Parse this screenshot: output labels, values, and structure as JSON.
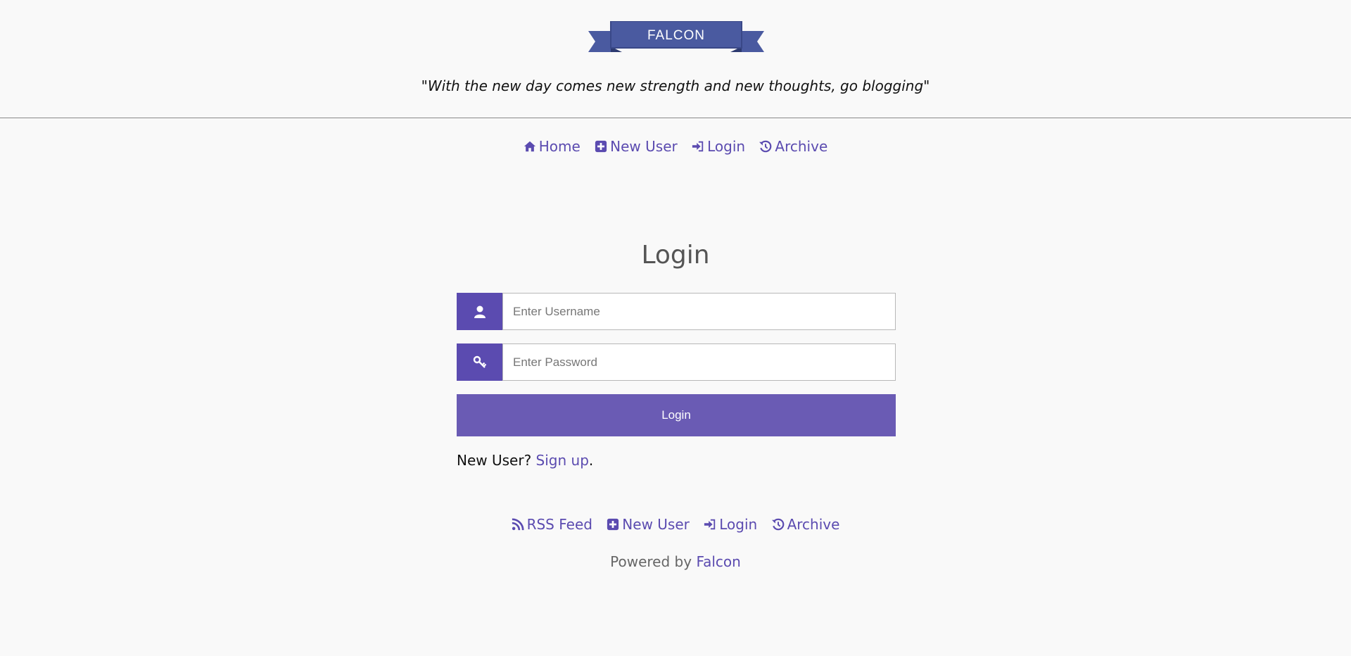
{
  "brand": {
    "logo_text": "FALCON",
    "tagline": "\"With the new day comes new strength and new thoughts, go blogging\"",
    "ribbon_color": "#4a5aa0"
  },
  "nav": {
    "items": [
      {
        "label": "Home",
        "icon": "home-icon"
      },
      {
        "label": "New User",
        "icon": "plus-square-icon"
      },
      {
        "label": "Login",
        "icon": "sign-in-icon"
      },
      {
        "label": "Archive",
        "icon": "history-icon"
      }
    ]
  },
  "login": {
    "title": "Login",
    "username_placeholder": "Enter Username",
    "password_placeholder": "Enter Password",
    "button_label": "Login",
    "signup_prefix": "New User?",
    "signup_link": "Sign up",
    "signup_suffix": "."
  },
  "footer": {
    "items": [
      {
        "label": "RSS Feed",
        "icon": "rss-icon"
      },
      {
        "label": "New User",
        "icon": "plus-square-icon"
      },
      {
        "label": "Login",
        "icon": "sign-in-icon"
      },
      {
        "label": "Archive",
        "icon": "history-icon"
      }
    ],
    "powered_prefix": "Powered by",
    "powered_link": "Falcon"
  },
  "colors": {
    "accent": "#5b4bb0",
    "button": "#6a5bb4",
    "background": "#f9f9f9"
  }
}
